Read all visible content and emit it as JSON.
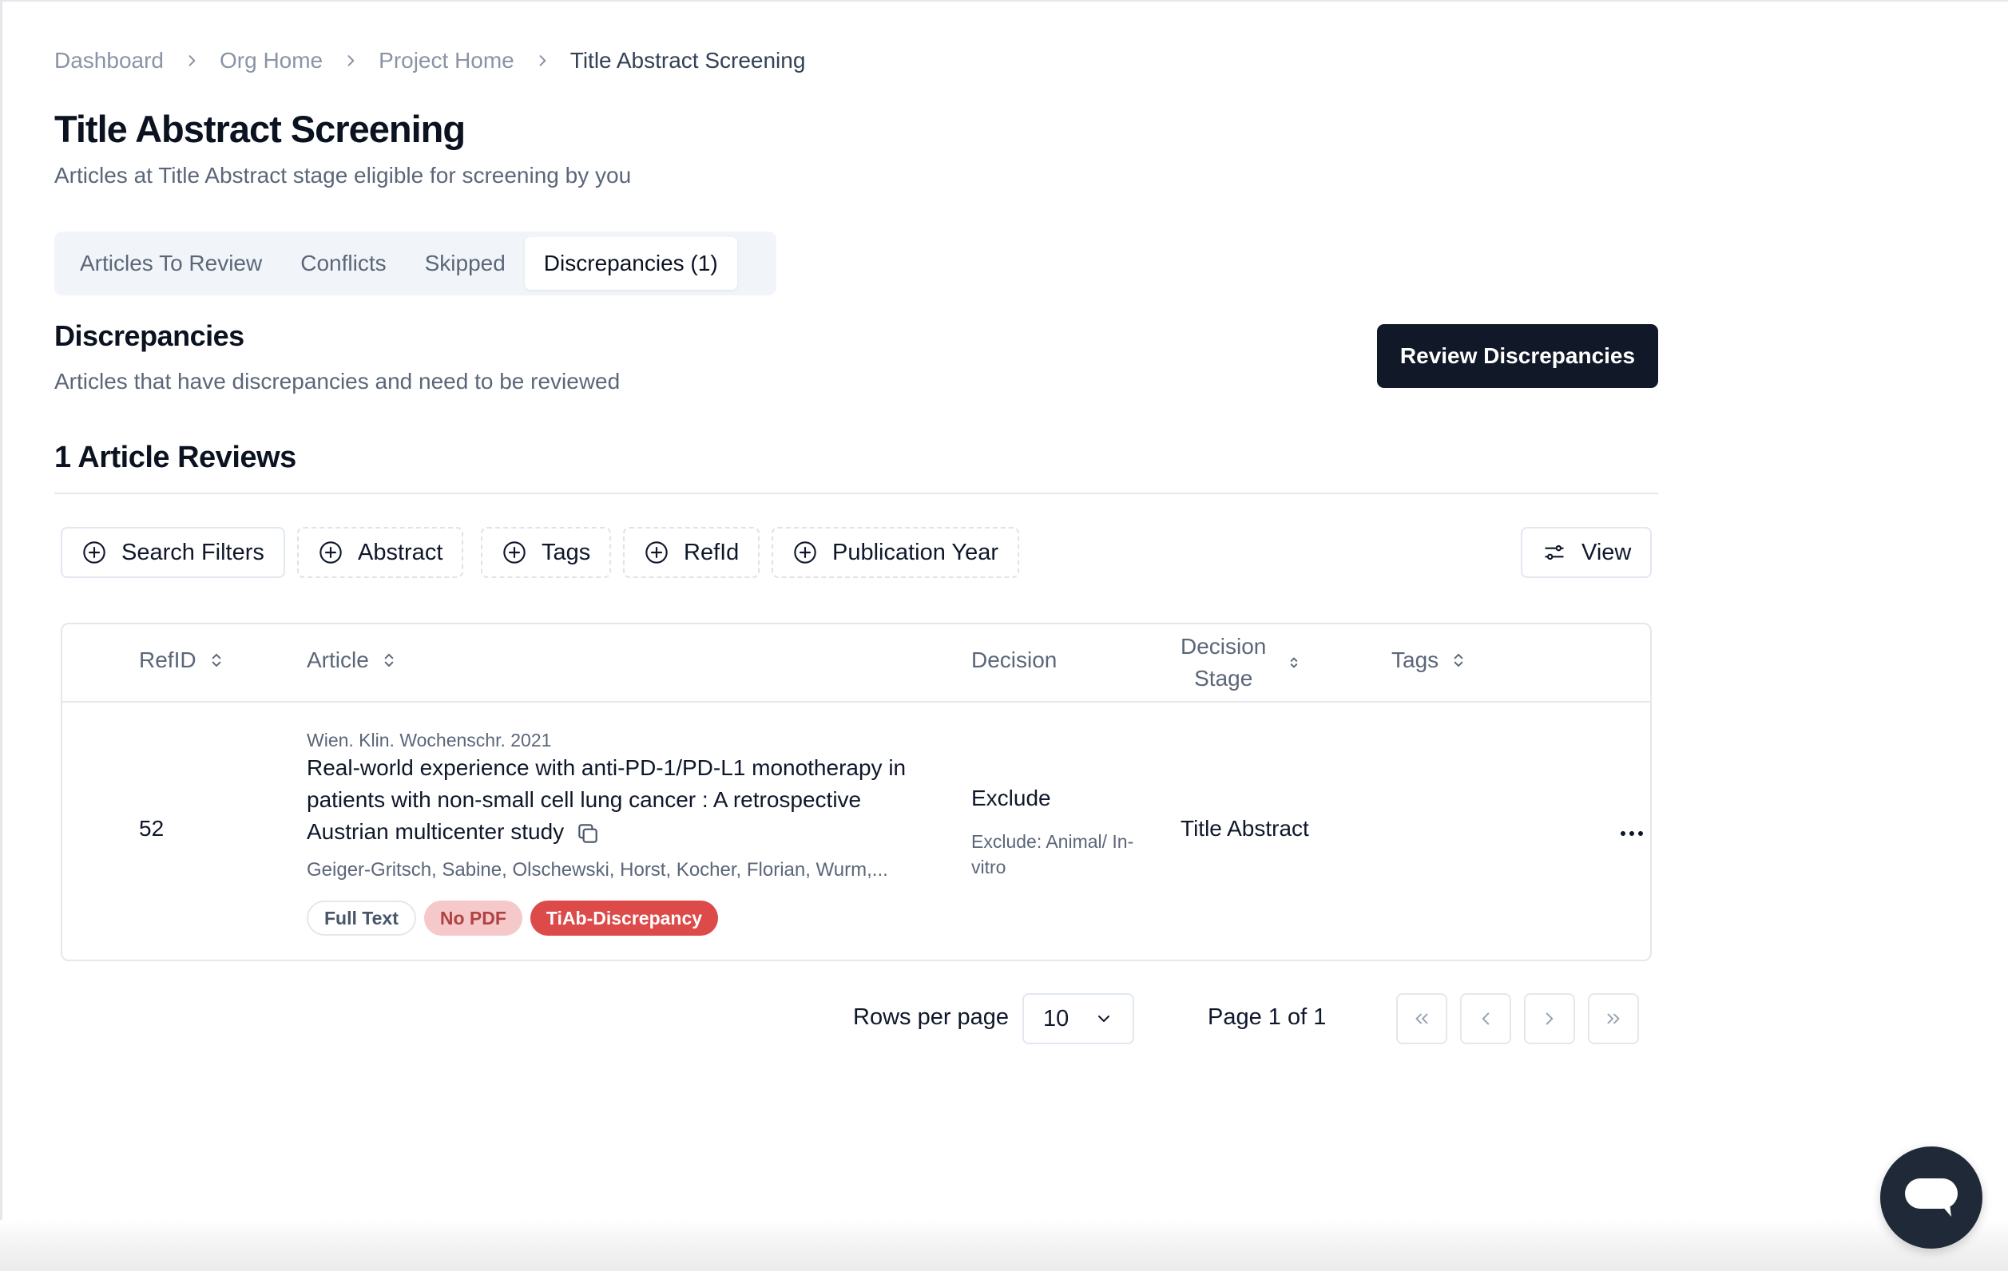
{
  "breadcrumb": {
    "items": [
      "Dashboard",
      "Org Home",
      "Project Home"
    ],
    "current": "Title Abstract Screening"
  },
  "page": {
    "title": "Title Abstract Screening",
    "subtitle": "Articles at Title Abstract stage eligible for screening by you"
  },
  "tabs": [
    {
      "label": "Articles To Review",
      "active": false
    },
    {
      "label": "Conflicts",
      "active": false
    },
    {
      "label": "Skipped",
      "active": false
    },
    {
      "label": "Discrepancies (1)",
      "active": true
    }
  ],
  "section": {
    "title": "Discrepancies",
    "description": "Articles that have discrepancies and need to be reviewed",
    "action_label": "Review Discrepancies"
  },
  "reviews_count": "1 Article Reviews",
  "filters": {
    "items": [
      "Search Filters",
      "Abstract",
      "Tags",
      "RefId",
      "Publication Year"
    ],
    "view_label": "View"
  },
  "table": {
    "headers": {
      "refid": "RefID",
      "article": "Article",
      "decision": "Decision",
      "decision_stage_line1": "Decision",
      "decision_stage_line2": "Stage",
      "tags": "Tags"
    },
    "rows": [
      {
        "refid": "52",
        "journal": "Wien. Klin. Wochenschr. 2021",
        "title": "Real-world experience with anti-PD-1/PD-L1 monotherapy in patients with non-small cell lung cancer : A retrospective Austrian multicenter study",
        "authors": "Geiger-Gritsch, Sabine, Olschewski, Horst, Kocher, Florian, Wurm,...",
        "badges": [
          "Full Text",
          "No PDF",
          "TiAb-Discrepancy"
        ],
        "decision": "Exclude",
        "decision_reason": "Exclude: Animal/ In-vitro",
        "decision_stage": "Title Abstract"
      }
    ]
  },
  "pagination": {
    "rows_per_page_label": "Rows per page",
    "rows_per_page_value": "10",
    "page_info": "Page 1 of 1"
  },
  "colors": {
    "primary_button": "#111827",
    "discrepancy_badge": "#dc4a4a",
    "no_pdf_badge": "#f5c9c9",
    "muted_text": "#5b6678"
  },
  "icons": {
    "breadcrumb_separator": "chevron-right-icon",
    "filter_add": "plus-circle-icon",
    "view": "sliders-icon",
    "sort": "sort-icon",
    "copy": "copy-icon",
    "row_menu": "more-horizontal-icon",
    "chat": "chat-icon"
  }
}
